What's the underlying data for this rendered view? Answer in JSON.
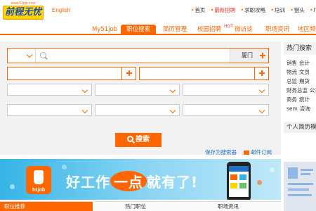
{
  "header": {
    "logo_url_text": "www.51job.com",
    "logo_text": "前程无忧",
    "lang_link": "English",
    "topnav": [
      {
        "label": "首页",
        "hot": false
      },
      {
        "label": "最新招聘",
        "hot": true
      },
      {
        "label": "求职攻略",
        "hot": false
      },
      {
        "label": "培训",
        "hot": false
      },
      {
        "label": "猎头",
        "hot": false
      },
      {
        "label": "IT",
        "hot": false
      }
    ]
  },
  "mainnav": {
    "my": "My51job",
    "search": "职位搜索",
    "resume": "简历管理",
    "campus": "校园招聘",
    "interview": "微访谈",
    "news": "职场资讯",
    "region": "地区频道",
    "hot_badge": "HOT"
  },
  "search": {
    "city": "厦门",
    "button_label": "搜索",
    "save_link": "保存为搜索器",
    "subscribe_link": "邮件订阅"
  },
  "sidebar": {
    "hot_title": "热门搜索",
    "hot_rows": [
      [
        "销售",
        "会计"
      ],
      [
        "物流",
        "文员"
      ],
      [
        "总监",
        "期货"
      ],
      [
        "财务总监",
        "公司"
      ],
      [
        "商务",
        "统计"
      ],
      [
        "sem",
        "咨询"
      ]
    ],
    "resume_title": "个人简历模板"
  },
  "banner": {
    "logo_label": "51job",
    "slogan_pre": "好工作",
    "slogan_hl": "一点",
    "slogan_post": "就有了!"
  },
  "bottom_tabs": [
    "职位推荐",
    "热门职位",
    "职场资讯"
  ],
  "colors": {
    "accent": "#ff6600",
    "link": "#1f6fc5",
    "logo_yellow": "#ffd400"
  }
}
